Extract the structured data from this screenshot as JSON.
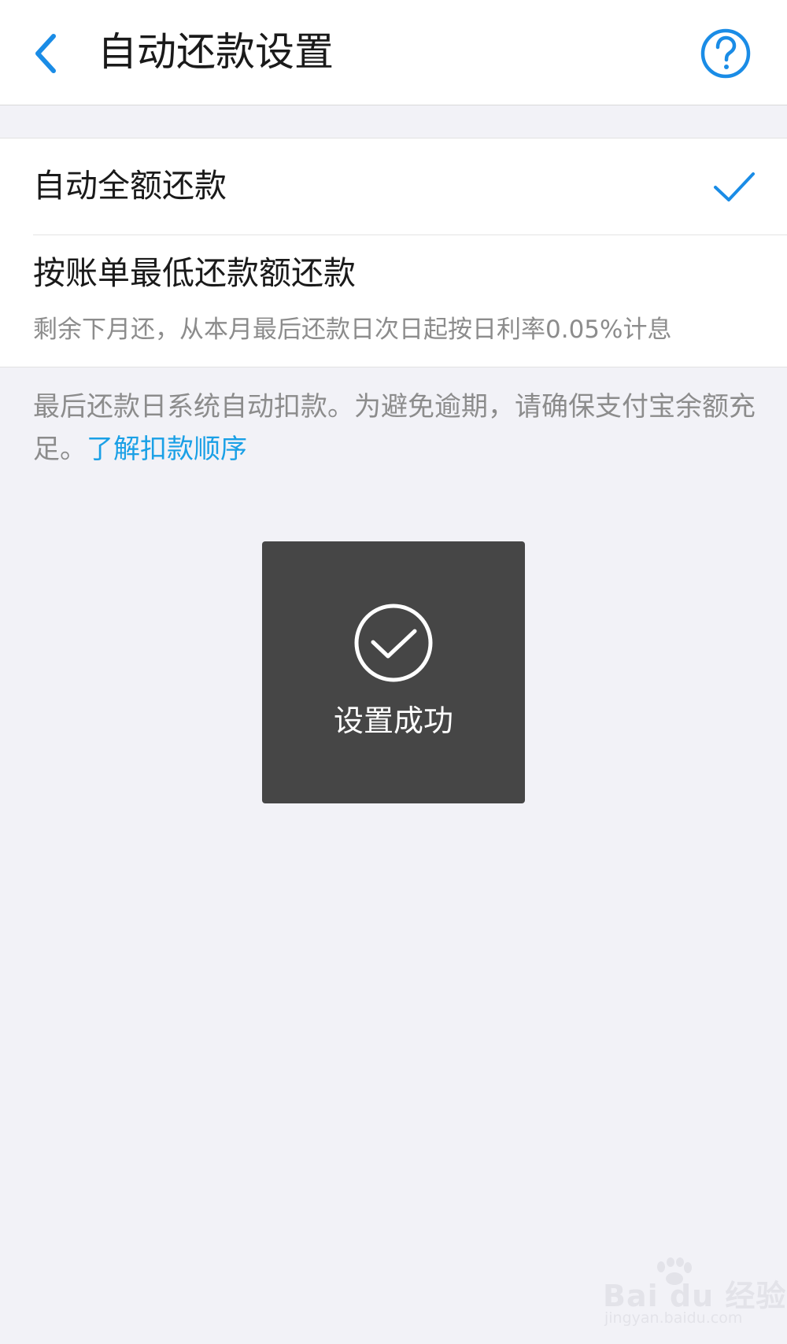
{
  "header": {
    "title": "自动还款设置",
    "back_icon": "chevron-left-icon",
    "help_icon": "question-circle-icon"
  },
  "options": {
    "full": {
      "label": "自动全额还款",
      "selected": true,
      "check_icon": "checkmark-icon"
    },
    "minimum": {
      "label": "按账单最低还款额还款",
      "description": "剩余下月还，从本月最后还款日次日起按日利率0.05%计息",
      "selected": false
    }
  },
  "notice": {
    "text": "最后还款日系统自动扣款。为避免逾期，请确保支付宝余额充足。",
    "link": "了解扣款顺序"
  },
  "toast": {
    "icon": "check-circle-icon",
    "message": "设置成功"
  },
  "watermark": {
    "logo": "Bai du 经验",
    "url": "jingyan.baidu.com"
  },
  "colors": {
    "accent": "#1a8ce6",
    "link": "#1aa0e6",
    "toast_bg": "#464646",
    "page_bg": "#f2f2f7"
  }
}
